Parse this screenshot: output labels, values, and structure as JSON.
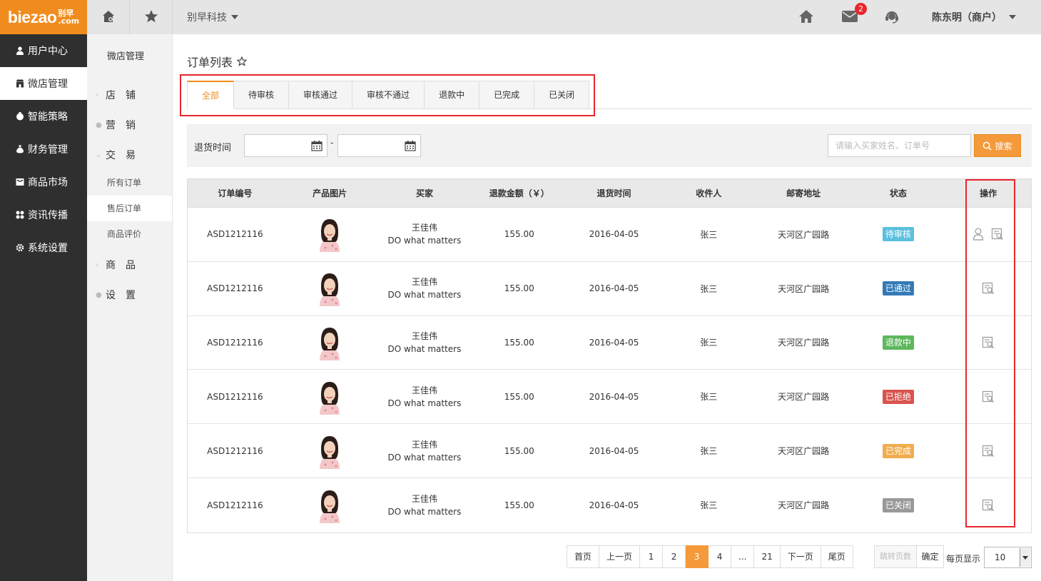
{
  "logo": {
    "main": "biezao",
    "cn": "别早",
    "com": ".com"
  },
  "header": {
    "company": "别早科技",
    "mail_badge": "2",
    "user": "陈东明（商户）"
  },
  "left_nav": [
    {
      "label": "用户中心",
      "icon": "user-icon"
    },
    {
      "label": "微店管理",
      "icon": "shop-icon",
      "active": true
    },
    {
      "label": "智能策略",
      "icon": "strategy-icon"
    },
    {
      "label": "财务管理",
      "icon": "money-bag-icon"
    },
    {
      "label": "商品市场",
      "icon": "market-icon"
    },
    {
      "label": "资讯传播",
      "icon": "grid-icon"
    },
    {
      "label": "系统设置",
      "icon": "settings-icon"
    }
  ],
  "sub_nav": {
    "title": "微店管理",
    "g1": "店　铺",
    "g2": "营　销",
    "g3": "交　易",
    "s1": "所有订单",
    "s2": "售后订单",
    "s3": "商品评价",
    "g4": "商　品",
    "g5": "设　置"
  },
  "page": {
    "title": "订单列表",
    "tabs": [
      "全部",
      "待审核",
      "审核通过",
      "审核不通过",
      "退款中",
      "已完成",
      "已关闭"
    ],
    "filter_label": "退货时间",
    "date_separator": "-",
    "search_placeholder": "请输入买家姓名、订单号",
    "search_button": "搜索"
  },
  "table": {
    "columns": [
      "订单编号",
      "产品图片",
      "买家",
      "退款金额（￥）",
      "退货时间",
      "收件人",
      "邮寄地址",
      "状态",
      "操作"
    ],
    "rows": [
      {
        "order": "ASD1212116",
        "buyer_name": "王佳伟",
        "buyer_note": "DO what matters",
        "amount": "155.00",
        "date": "2016-04-05",
        "recipient": "张三",
        "address": "天河区广园路",
        "status": "待审核",
        "status_color": "#5bc0de"
      },
      {
        "order": "ASD1212116",
        "buyer_name": "王佳伟",
        "buyer_note": "DO what matters",
        "amount": "155.00",
        "date": "2016-04-05",
        "recipient": "张三",
        "address": "天河区广园路",
        "status": "已通过",
        "status_color": "#337ab7"
      },
      {
        "order": "ASD1212116",
        "buyer_name": "王佳伟",
        "buyer_note": "DO what matters",
        "amount": "155.00",
        "date": "2016-04-05",
        "recipient": "张三",
        "address": "天河区广园路",
        "status": "退款中",
        "status_color": "#5cb85c"
      },
      {
        "order": "ASD1212116",
        "buyer_name": "王佳伟",
        "buyer_note": "DO what matters",
        "amount": "155.00",
        "date": "2016-04-05",
        "recipient": "张三",
        "address": "天河区广园路",
        "status": "已拒绝",
        "status_color": "#d9534f"
      },
      {
        "order": "ASD1212116",
        "buyer_name": "王佳伟",
        "buyer_note": "DO what matters",
        "amount": "155.00",
        "date": "2016-04-05",
        "recipient": "张三",
        "address": "天河区广园路",
        "status": "已完成",
        "status_color": "#f0ad4e"
      },
      {
        "order": "ASD1212116",
        "buyer_name": "王佳伟",
        "buyer_note": "DO what matters",
        "amount": "155.00",
        "date": "2016-04-05",
        "recipient": "张三",
        "address": "天河区广园路",
        "status": "已关闭",
        "status_color": "#999999"
      }
    ]
  },
  "pagination": {
    "pages": [
      "首页",
      "上一页",
      "1",
      "2",
      "3",
      "4",
      "...",
      "21",
      "下一页",
      "尾页"
    ],
    "current": "3",
    "jump_placeholder": "跳转页数",
    "confirm": "确定",
    "per_page_label": "每页显示",
    "per_page": "10"
  },
  "colors": {
    "accent": "#f08c1e",
    "highlight_box": "#e8262d"
  }
}
